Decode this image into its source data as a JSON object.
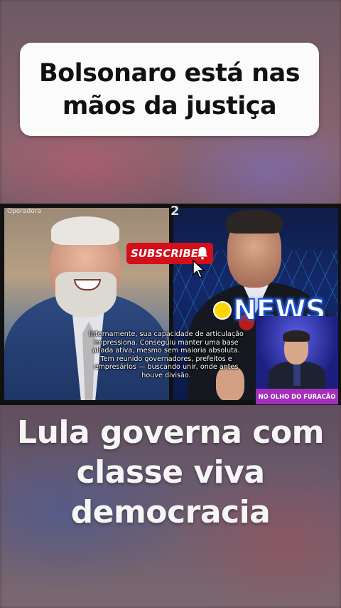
{
  "top_headline": "Bolsonaro está nas\nmãos da justiça",
  "video": {
    "left_panel_label": "Operadora",
    "right_panel_number": "2",
    "subscribe_label": "SUBSCRIBE",
    "news_badge": "NEWS",
    "caption": "Internamente, sua capacidade de articulação impressiona. Conseguiu manter uma base aliada ativa, mesmo sem maioria absoluta. Tem reunido governadores, prefeitos e empresários — buscando unir, onde antes houve divisão.",
    "anchor_label": "NO OLHO DO FURACÃO"
  },
  "bottom_headline": "Lula governa com\nclasse viva\ndemocracia",
  "colors": {
    "subscribe_red": "#d3101a",
    "news_blue": "#1b52d8",
    "news_dot_yellow": "#ffd400",
    "anchor_label_purple": "#a32fbd"
  },
  "icons": [
    "bell-icon",
    "cursor-icon"
  ]
}
